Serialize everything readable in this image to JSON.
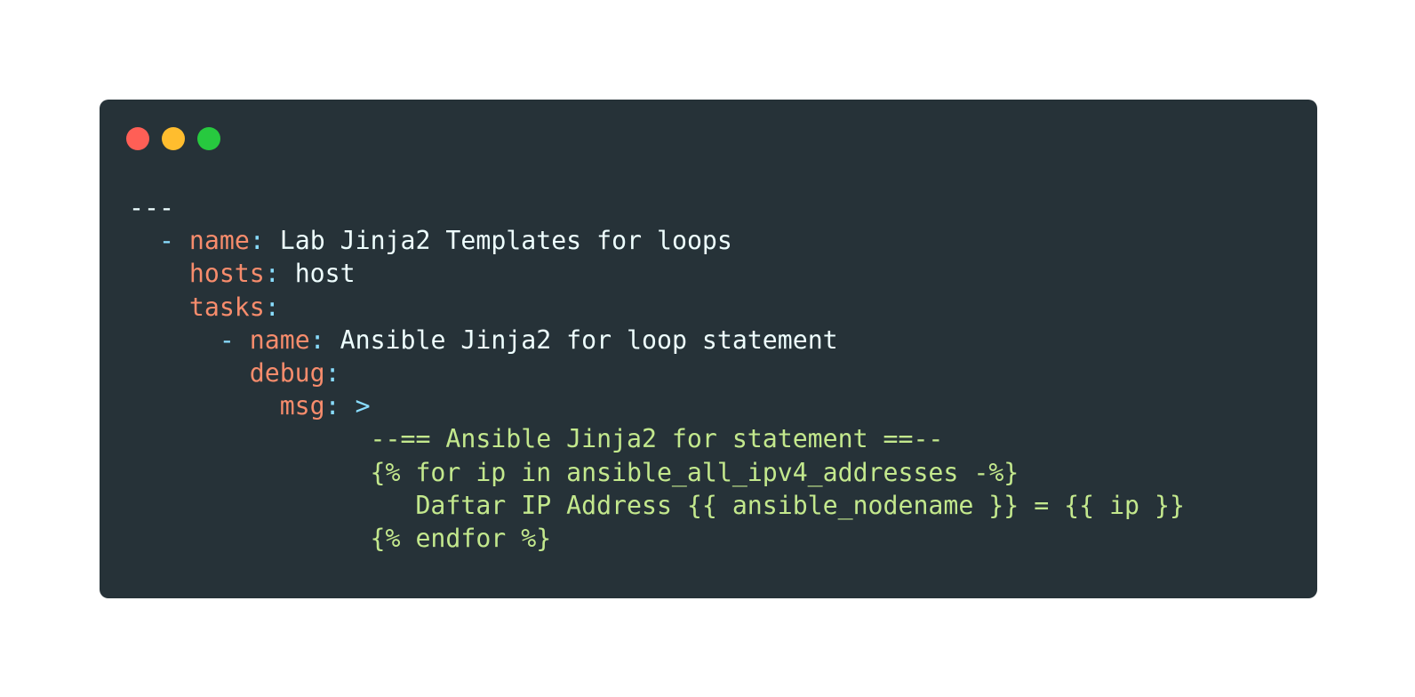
{
  "window": {
    "background": "#263238",
    "controls": [
      {
        "name": "close-dot",
        "color": "#ff5f56"
      },
      {
        "name": "minimize-dot",
        "color": "#ffbd2e"
      },
      {
        "name": "maximize-dot",
        "color": "#27c93f"
      }
    ]
  },
  "colors": {
    "key": "#f78c6c",
    "punct": "#89ddff",
    "string": "#c3e88d",
    "plain": "#eeffff"
  },
  "code": {
    "lines": [
      [
        {
          "t": "plain",
          "v": "---"
        }
      ],
      [
        {
          "t": "plain",
          "v": "  "
        },
        {
          "t": "punct",
          "v": "- "
        },
        {
          "t": "key",
          "v": "name"
        },
        {
          "t": "punct",
          "v": ": "
        },
        {
          "t": "plain",
          "v": "Lab Jinja2 Templates for loops"
        }
      ],
      [
        {
          "t": "plain",
          "v": "    "
        },
        {
          "t": "key",
          "v": "hosts"
        },
        {
          "t": "punct",
          "v": ": "
        },
        {
          "t": "plain",
          "v": "host"
        }
      ],
      [
        {
          "t": "plain",
          "v": "    "
        },
        {
          "t": "key",
          "v": "tasks"
        },
        {
          "t": "punct",
          "v": ":"
        }
      ],
      [
        {
          "t": "plain",
          "v": "      "
        },
        {
          "t": "punct",
          "v": "- "
        },
        {
          "t": "key",
          "v": "name"
        },
        {
          "t": "punct",
          "v": ": "
        },
        {
          "t": "plain",
          "v": "Ansible Jinja2 for loop statement"
        }
      ],
      [
        {
          "t": "plain",
          "v": "        "
        },
        {
          "t": "key",
          "v": "debug"
        },
        {
          "t": "punct",
          "v": ":"
        }
      ],
      [
        {
          "t": "plain",
          "v": "          "
        },
        {
          "t": "key",
          "v": "msg"
        },
        {
          "t": "punct",
          "v": ": >"
        }
      ],
      [
        {
          "t": "plain",
          "v": "                "
        },
        {
          "t": "string",
          "v": "--== Ansible Jinja2 for statement ==--"
        }
      ],
      [
        {
          "t": "plain",
          "v": "                "
        },
        {
          "t": "string",
          "v": "{% for ip in ansible_all_ipv4_addresses -%}"
        }
      ],
      [
        {
          "t": "plain",
          "v": "                   "
        },
        {
          "t": "string",
          "v": "Daftar IP Address {{ ansible_nodename }} = {{ ip }}"
        }
      ],
      [
        {
          "t": "plain",
          "v": "                "
        },
        {
          "t": "string",
          "v": "{% endfor %}"
        }
      ]
    ]
  }
}
